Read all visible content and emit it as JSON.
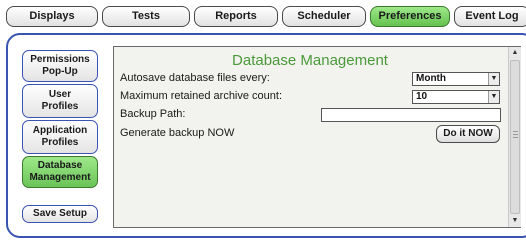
{
  "tabs": [
    {
      "label": "Displays",
      "active": false
    },
    {
      "label": "Tests",
      "active": false
    },
    {
      "label": "Reports",
      "active": false
    },
    {
      "label": "Scheduler",
      "active": false
    },
    {
      "label": "Preferences",
      "active": true
    },
    {
      "label": "Event Log",
      "active": false
    }
  ],
  "sidebar": {
    "items": [
      {
        "line1": "Permissions",
        "line2": "Pop-Up",
        "active": false
      },
      {
        "line1": "User",
        "line2": "Profiles",
        "active": false
      },
      {
        "line1": "Application",
        "line2": "Profiles",
        "active": false
      },
      {
        "line1": "Database",
        "line2": "Management",
        "active": true
      }
    ],
    "save_label": "Save Setup"
  },
  "panel": {
    "title": "Database Management",
    "autosave_label": "Autosave database files every:",
    "autosave_value": "Month",
    "archive_label": "Maximum retained archive count:",
    "archive_value": "10",
    "backup_path_label": "Backup Path:",
    "backup_path_value": "",
    "generate_label": "Generate backup NOW",
    "do_it_label": "Do it NOW"
  },
  "colors": {
    "frame_border": "#3a54b2",
    "active_green": "#64c24e",
    "title_green": "#4a9a3a",
    "panel_bg": "#f2f2ee"
  },
  "icons": {
    "dropdown": "chevron-down-icon",
    "scroll_up": "arrow-up-icon",
    "scroll_down": "arrow-down-icon"
  }
}
